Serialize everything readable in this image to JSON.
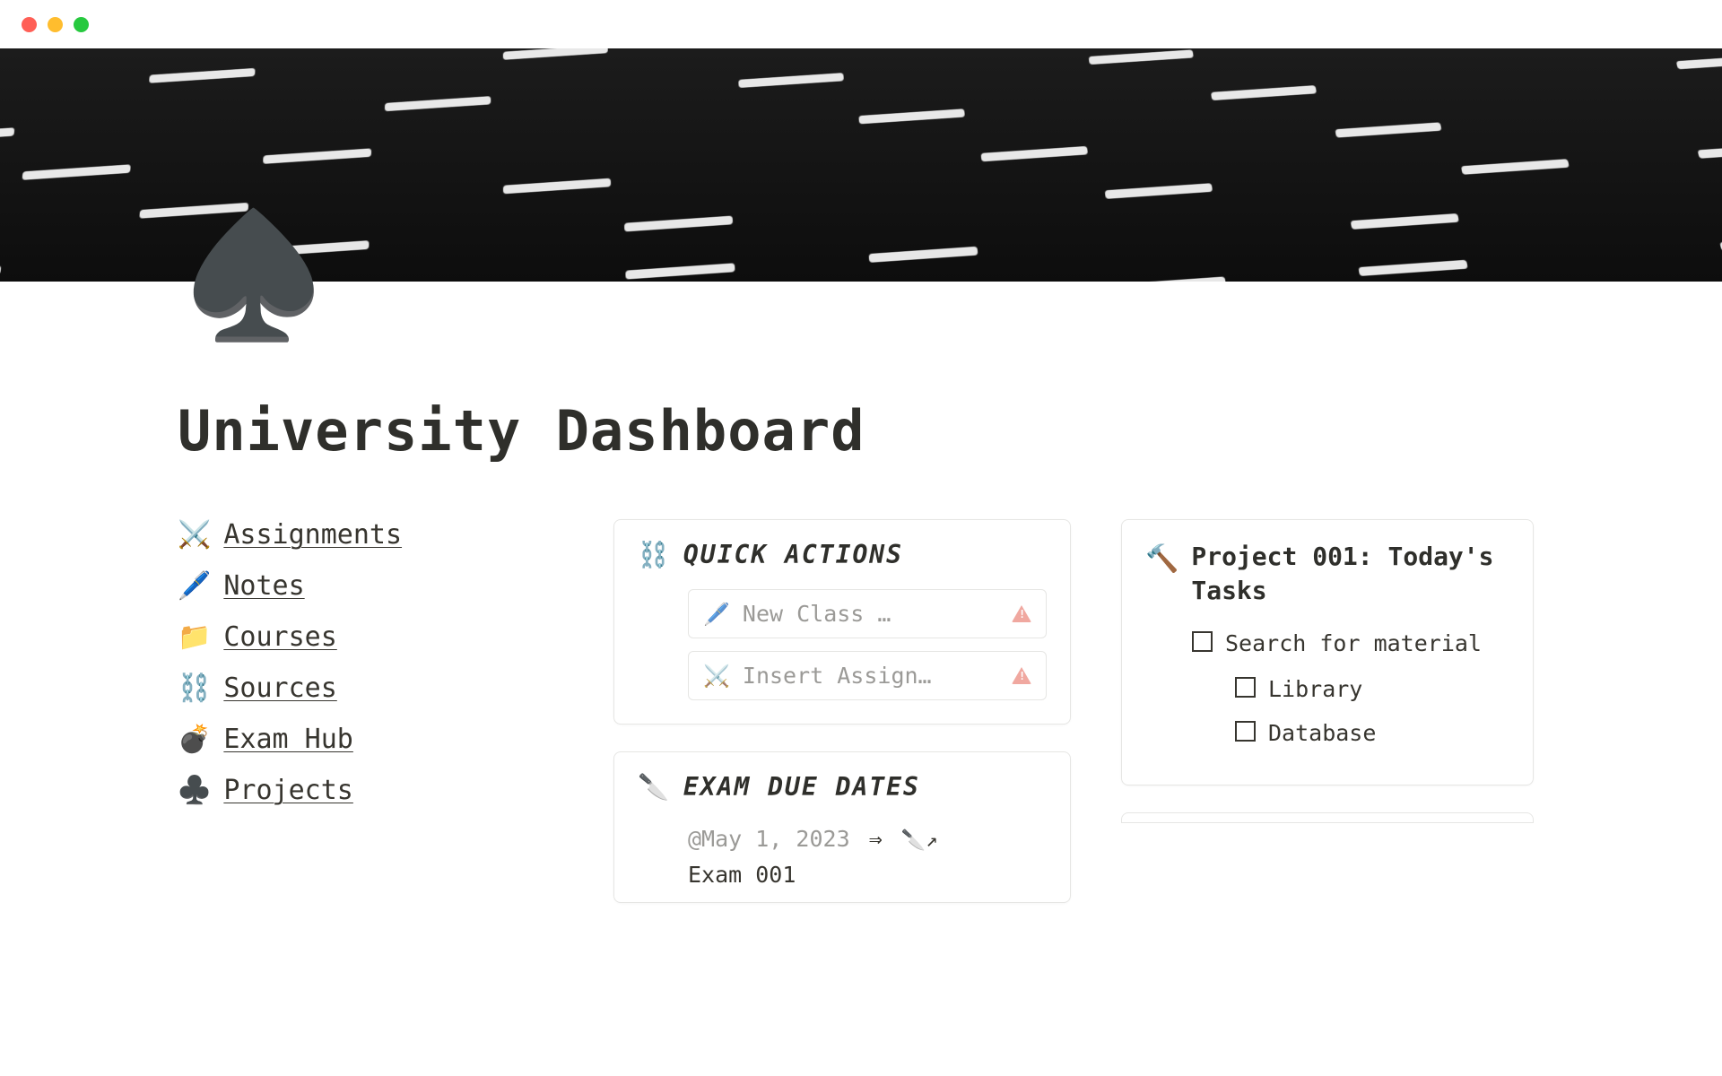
{
  "page": {
    "icon": "♠️",
    "title": "University Dashboard"
  },
  "nav": {
    "items": [
      {
        "icon": "⚔️",
        "label": "Assignments"
      },
      {
        "icon": "🖊️",
        "label": "Notes"
      },
      {
        "icon": "📁",
        "label": "Courses"
      },
      {
        "icon": "⛓️",
        "label": "Sources"
      },
      {
        "icon": "💣",
        "label": "Exam Hub"
      },
      {
        "icon": "♣️",
        "label": "Projects"
      }
    ]
  },
  "quick_actions": {
    "icon": "⛓️",
    "title": "QUICK ACTIONS",
    "items": [
      {
        "icon": "🖊️",
        "label": "New Class …",
        "warn": true
      },
      {
        "icon": "⚔️",
        "label": "Insert Assign…",
        "warn": true
      }
    ]
  },
  "exam_due": {
    "icon": "🔪",
    "title": "EXAM DUE DATES",
    "date": "@May 1, 2023",
    "arrow": "⇒",
    "link_icon": "🔪↗",
    "name": "Exam 001"
  },
  "project": {
    "icon": "🔨",
    "title": "Project 001: Today's Tasks",
    "tasks": {
      "main": "Search for material",
      "subs": [
        "Library",
        "Database"
      ]
    }
  }
}
